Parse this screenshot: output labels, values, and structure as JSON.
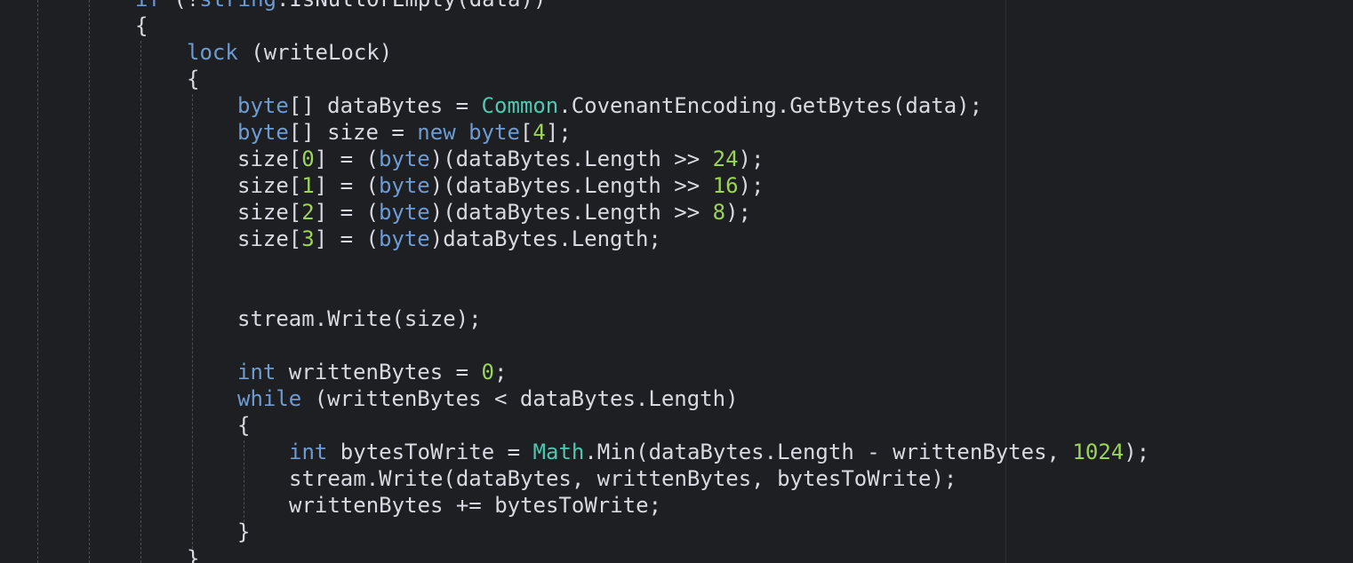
{
  "editor": {
    "colors": {
      "background": "#1e1f22",
      "text": "#d7dae0",
      "keyword": "#6d9bd4",
      "class": "#4ec9b0",
      "number": "#9bd457",
      "guide": "#4a4c52"
    },
    "lines": [
      {
        "tokens": [
          {
            "t": "kw",
            "v": "if"
          },
          {
            "t": "txt",
            "v": " (!"
          },
          {
            "t": "kw",
            "v": "string"
          },
          {
            "t": "txt",
            "v": ".IsNullOrEmpty(data))"
          }
        ]
      },
      {
        "tokens": [
          {
            "t": "txt",
            "v": "{"
          }
        ]
      },
      {
        "tokens": [
          {
            "t": "kw",
            "v": "lock"
          },
          {
            "t": "txt",
            "v": " (writeLock)"
          }
        ]
      },
      {
        "tokens": [
          {
            "t": "txt",
            "v": "{"
          }
        ]
      },
      {
        "tokens": [
          {
            "t": "ty",
            "v": "byte"
          },
          {
            "t": "txt",
            "v": "[] dataBytes = "
          },
          {
            "t": "cls",
            "v": "Common"
          },
          {
            "t": "txt",
            "v": ".CovenantEncoding.GetBytes(data);"
          }
        ]
      },
      {
        "tokens": [
          {
            "t": "ty",
            "v": "byte"
          },
          {
            "t": "txt",
            "v": "[] size = "
          },
          {
            "t": "kw",
            "v": "new"
          },
          {
            "t": "txt",
            "v": " "
          },
          {
            "t": "ty",
            "v": "byte"
          },
          {
            "t": "txt",
            "v": "["
          },
          {
            "t": "num",
            "v": "4"
          },
          {
            "t": "txt",
            "v": "];"
          }
        ]
      },
      {
        "tokens": [
          {
            "t": "txt",
            "v": "size["
          },
          {
            "t": "num",
            "v": "0"
          },
          {
            "t": "txt",
            "v": "] = ("
          },
          {
            "t": "ty",
            "v": "byte"
          },
          {
            "t": "txt",
            "v": ")(dataBytes.Length >> "
          },
          {
            "t": "num",
            "v": "24"
          },
          {
            "t": "txt",
            "v": ");"
          }
        ]
      },
      {
        "tokens": [
          {
            "t": "txt",
            "v": "size["
          },
          {
            "t": "num",
            "v": "1"
          },
          {
            "t": "txt",
            "v": "] = ("
          },
          {
            "t": "ty",
            "v": "byte"
          },
          {
            "t": "txt",
            "v": ")(dataBytes.Length >> "
          },
          {
            "t": "num",
            "v": "16"
          },
          {
            "t": "txt",
            "v": ");"
          }
        ]
      },
      {
        "tokens": [
          {
            "t": "txt",
            "v": "size["
          },
          {
            "t": "num",
            "v": "2"
          },
          {
            "t": "txt",
            "v": "] = ("
          },
          {
            "t": "ty",
            "v": "byte"
          },
          {
            "t": "txt",
            "v": ")(dataBytes.Length >> "
          },
          {
            "t": "num",
            "v": "8"
          },
          {
            "t": "txt",
            "v": ");"
          }
        ]
      },
      {
        "tokens": [
          {
            "t": "txt",
            "v": "size["
          },
          {
            "t": "num",
            "v": "3"
          },
          {
            "t": "txt",
            "v": "] = ("
          },
          {
            "t": "ty",
            "v": "byte"
          },
          {
            "t": "txt",
            "v": ")dataBytes.Length;"
          }
        ]
      },
      {
        "tokens": []
      },
      {
        "tokens": []
      },
      {
        "tokens": [
          {
            "t": "txt",
            "v": "stream.Write(size);"
          }
        ]
      },
      {
        "tokens": []
      },
      {
        "tokens": [
          {
            "t": "ty",
            "v": "int"
          },
          {
            "t": "txt",
            "v": " writtenBytes = "
          },
          {
            "t": "num",
            "v": "0"
          },
          {
            "t": "txt",
            "v": ";"
          }
        ]
      },
      {
        "tokens": [
          {
            "t": "kw",
            "v": "while"
          },
          {
            "t": "txt",
            "v": " (writtenBytes < dataBytes.Length)"
          }
        ]
      },
      {
        "tokens": [
          {
            "t": "txt",
            "v": "{"
          }
        ]
      },
      {
        "tokens": [
          {
            "t": "ty",
            "v": "int"
          },
          {
            "t": "txt",
            "v": " bytesToWrite = "
          },
          {
            "t": "cls",
            "v": "Math"
          },
          {
            "t": "txt",
            "v": ".Min(dataBytes.Length - writtenBytes, "
          },
          {
            "t": "num",
            "v": "1024"
          },
          {
            "t": "txt",
            "v": ");"
          }
        ]
      },
      {
        "tokens": [
          {
            "t": "txt",
            "v": "stream.Write(dataBytes, writtenBytes, bytesToWrite);"
          }
        ]
      },
      {
        "tokens": [
          {
            "t": "txt",
            "v": "writtenBytes += bytesToWrite;"
          }
        ]
      },
      {
        "tokens": [
          {
            "t": "txt",
            "v": "}"
          }
        ]
      },
      {
        "tokens": [
          {
            "t": "txt",
            "v": "}"
          }
        ]
      }
    ]
  }
}
